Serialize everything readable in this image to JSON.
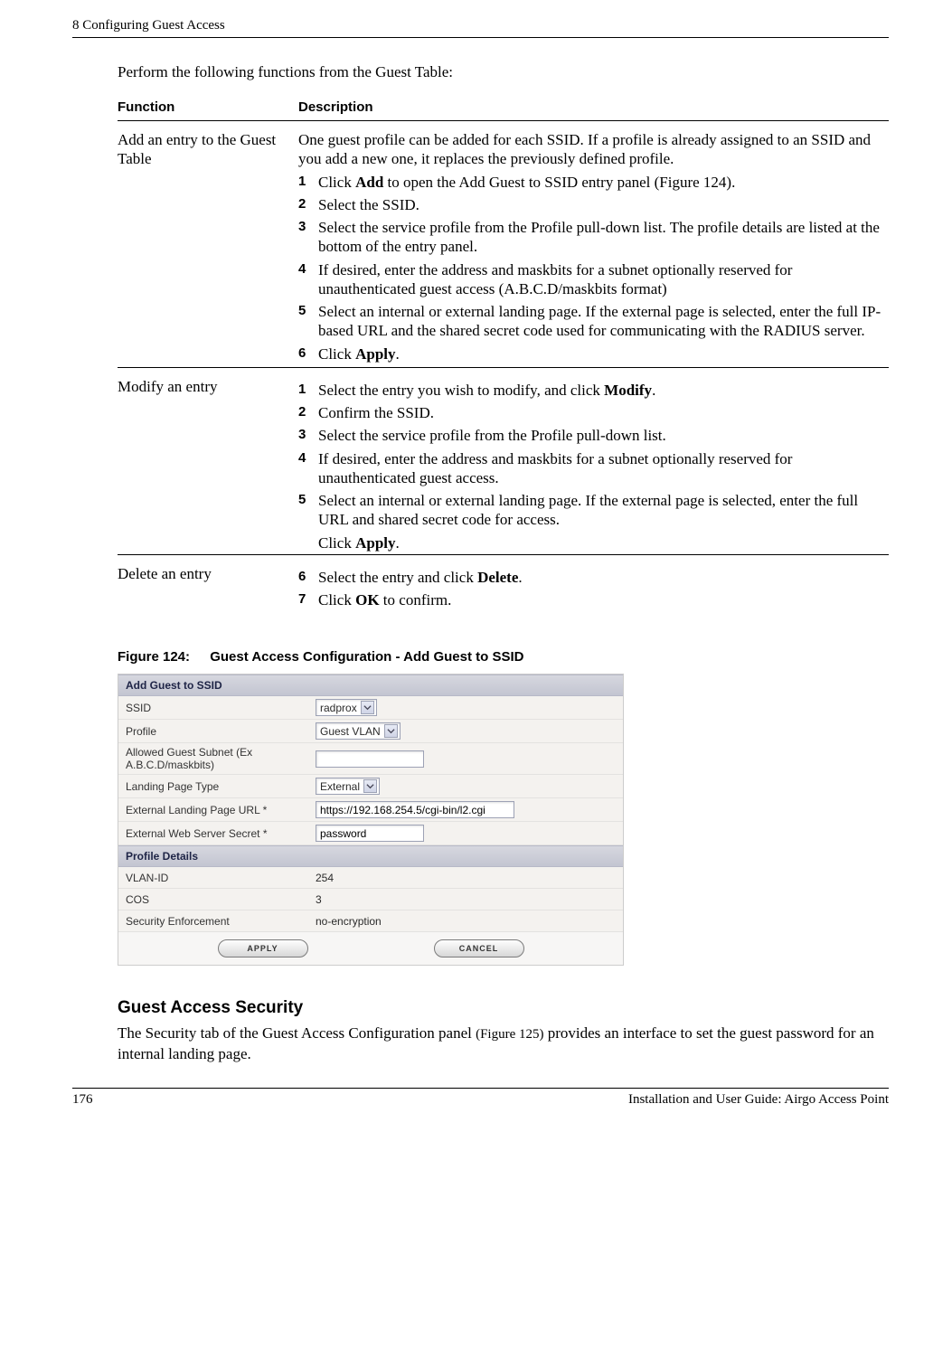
{
  "header": {
    "chapter": "8  Configuring Guest Access"
  },
  "intro": "Perform the following functions from the Guest Table:",
  "table": {
    "head_function": "Function",
    "head_description": "Description",
    "rows": [
      {
        "function": "Add an entry to the Guest Table",
        "desc_pre": "One guest profile can be added for each SSID. If a profile is already assigned to an SSID and you add a new one, it replaces the previously defined profile.",
        "steps": [
          {
            "n": "1",
            "pre": "Click ",
            "bold": "Add",
            "post": " to open the Add Guest to SSID entry panel (Figure 124)."
          },
          {
            "n": "2",
            "text": "Select the SSID."
          },
          {
            "n": "3",
            "text": "Select the service profile from the Profile pull-down list. The profile details are listed at the bottom of the entry panel."
          },
          {
            "n": "4",
            "text": "If desired, enter the address and maskbits for a subnet optionally reserved for unauthenticated guest access (A.B.C.D/maskbits format)"
          },
          {
            "n": "5",
            "text": "Select an internal or external landing page. If the external page is selected, enter the full IP-based URL and the shared secret code used for communicating with the RADIUS server."
          },
          {
            "n": "6",
            "pre": "Click ",
            "bold": "Apply",
            "post": "."
          }
        ]
      },
      {
        "function": "Modify an entry",
        "steps": [
          {
            "n": "1",
            "pre": "Select the entry you wish to modify, and click ",
            "bold": "Modify",
            "post": "."
          },
          {
            "n": "2",
            "text": "Confirm the SSID."
          },
          {
            "n": "3",
            "text": "Select the service profile from the Profile pull-down list."
          },
          {
            "n": "4",
            "text": "If desired, enter the address and maskbits for a subnet optionally reserved for unauthenticated guest access."
          },
          {
            "n": "5",
            "text": "Select an internal or external landing page. If the external page is selected, enter the full URL and shared secret code for access."
          }
        ],
        "after": {
          "pre": "Click ",
          "bold": "Apply",
          "post": "."
        }
      },
      {
        "function": "Delete an entry",
        "steps": [
          {
            "n": "6",
            "pre": "Select the entry and click ",
            "bold": "Delete",
            "post": "."
          },
          {
            "n": "7",
            "pre": "Click ",
            "bold": "OK",
            "post": " to confirm."
          }
        ]
      }
    ]
  },
  "figure_caption": {
    "num": "Figure 124:",
    "title": "Guest Access Configuration - Add Guest to SSID"
  },
  "screenshot": {
    "section1": "Add Guest to SSID",
    "rows": [
      {
        "label": "SSID",
        "type": "select",
        "value": "radprox"
      },
      {
        "label": "Profile",
        "type": "select",
        "value": "Guest VLAN"
      },
      {
        "label": "Allowed Guest Subnet (Ex A.B.C.D/maskbits)",
        "type": "input",
        "value": ""
      },
      {
        "label": "Landing Page Type",
        "type": "select",
        "value": "External"
      },
      {
        "label": "External Landing Page URL  *",
        "type": "input",
        "value": "https://192.168.254.5/cgi-bin/l2.cgi",
        "wide": true
      },
      {
        "label": "External Web Server Secret  *",
        "type": "input",
        "value": "password"
      }
    ],
    "section2": "Profile Details",
    "details": [
      {
        "label": "VLAN-ID",
        "value": "254"
      },
      {
        "label": "COS",
        "value": "3"
      },
      {
        "label": "Security Enforcement",
        "value": "no-encryption"
      }
    ],
    "btn_apply": "APPLY",
    "btn_cancel": "CANCEL"
  },
  "section2_heading": "Guest Access Security",
  "section2_para_pre": "The Security tab of the Guest Access Configuration panel ",
  "section2_para_fig": "(Figure 125)",
  "section2_para_post": " provides an interface to set the guest password for an internal landing page.",
  "footer": {
    "page": "176",
    "right": "Installation and User Guide: Airgo Access Point"
  }
}
